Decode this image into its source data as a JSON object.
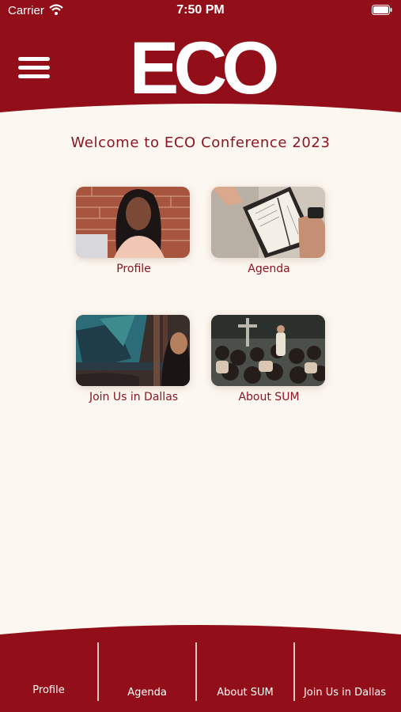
{
  "status_bar": {
    "carrier": "Carrier",
    "time": "7:50 PM"
  },
  "header": {
    "logo": "ECO",
    "menu_icon": "hamburger-menu-icon"
  },
  "welcome": "Welcome to ECO Conference 2023",
  "tiles": [
    {
      "label": "Profile"
    },
    {
      "label": "Agenda"
    },
    {
      "label": "Join Us in Dallas"
    },
    {
      "label": "About SUM"
    }
  ],
  "tab_bar": {
    "items": [
      {
        "label": "Profile"
      },
      {
        "label": "Agenda"
      },
      {
        "label": "About SUM"
      },
      {
        "label": "Join Us in Dallas"
      }
    ]
  },
  "colors": {
    "brand": "#920e18",
    "background": "#fcf8f1",
    "text_accent": "#8c1521"
  }
}
